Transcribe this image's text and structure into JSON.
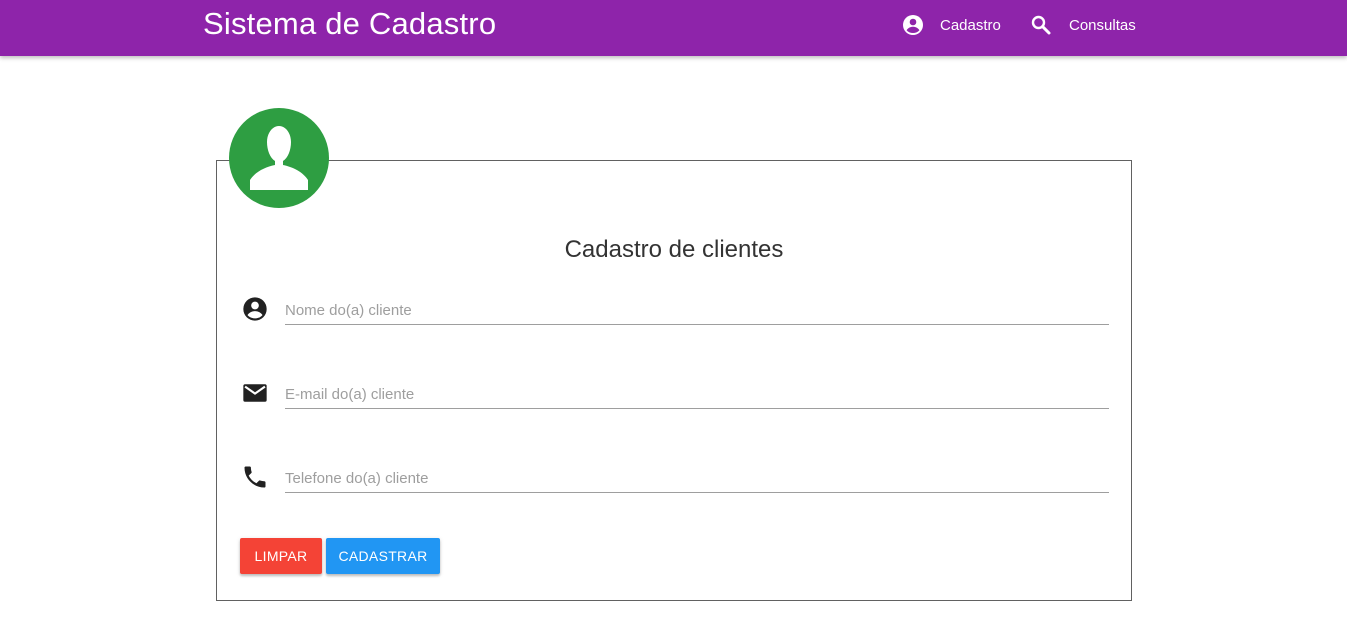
{
  "navbar": {
    "brand": "Sistema de Cadastro",
    "items": [
      {
        "label": "Cadastro",
        "icon": "account-circle-icon"
      },
      {
        "label": "Consultas",
        "icon": "search-icon"
      }
    ],
    "color": "#8e24aa"
  },
  "form": {
    "title": "Cadastro de clientes",
    "avatar_color": "#2e9e42",
    "fields": [
      {
        "icon": "account-circle-icon",
        "placeholder": "Nome do(a) cliente",
        "value": ""
      },
      {
        "icon": "email-icon",
        "placeholder": "E-mail do(a) cliente",
        "value": ""
      },
      {
        "icon": "phone-icon",
        "placeholder": "Telefone do(a) cliente",
        "value": ""
      }
    ],
    "buttons": {
      "clear_label": "LIMPAR",
      "clear_color": "#f44336",
      "submit_label": "CADASTRAR",
      "submit_color": "#2196f3"
    }
  }
}
